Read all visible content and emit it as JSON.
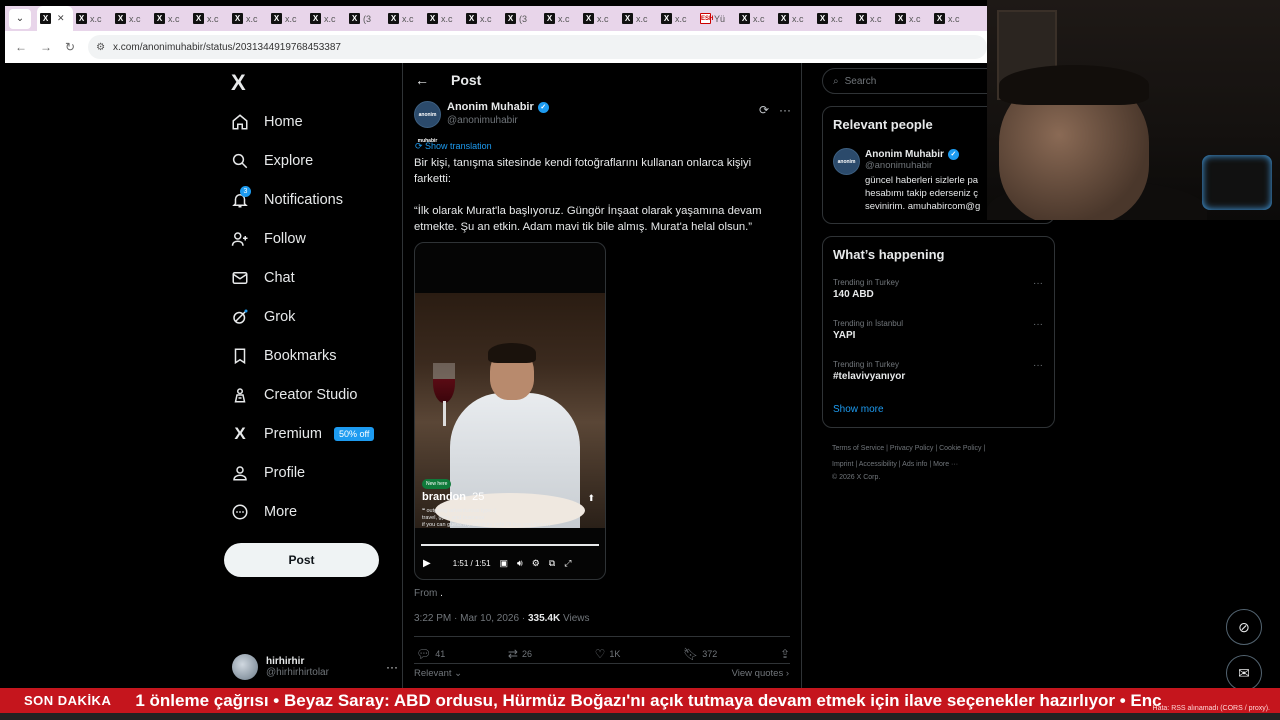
{
  "browser": {
    "tabs": [
      {
        "label": "",
        "icon": "x-icon",
        "active": true
      },
      {
        "label": "x.c",
        "icon": "x-icon"
      },
      {
        "label": "x.c",
        "icon": "x-icon"
      },
      {
        "label": "x.c",
        "icon": "x-icon"
      },
      {
        "label": "x.c",
        "icon": "x-icon"
      },
      {
        "label": "x.c",
        "icon": "x-icon"
      },
      {
        "label": "x.c",
        "icon": "x-icon"
      },
      {
        "label": "x.c",
        "icon": "x-icon"
      },
      {
        "label": "(3",
        "icon": "x-icon"
      },
      {
        "label": "x.c",
        "icon": "x-icon"
      },
      {
        "label": "x.c",
        "icon": "x-icon"
      },
      {
        "label": "x.c",
        "icon": "x-icon"
      },
      {
        "label": "(3",
        "icon": "x-icon"
      },
      {
        "label": "x.c",
        "icon": "x-icon"
      },
      {
        "label": "x.c",
        "icon": "x-icon"
      },
      {
        "label": "x.c",
        "icon": "x-icon"
      },
      {
        "label": "x.c",
        "icon": "x-icon"
      },
      {
        "label": "Yü",
        "icon": "news-icon"
      },
      {
        "label": "x.c",
        "icon": "x-icon"
      },
      {
        "label": "x.c",
        "icon": "x-icon"
      },
      {
        "label": "x.c",
        "icon": "x-icon"
      },
      {
        "label": "x.c",
        "icon": "x-icon"
      },
      {
        "label": "x.c",
        "icon": "x-icon"
      },
      {
        "label": "x.c",
        "icon": "x-icon"
      }
    ],
    "url": "x.com/anonimuhabir/status/2031344919768453387"
  },
  "nav": {
    "logo": "X",
    "items": [
      {
        "label": "Home",
        "icon": "home-icon"
      },
      {
        "label": "Explore",
        "icon": "search-icon"
      },
      {
        "label": "Notifications",
        "icon": "bell-icon",
        "badge": "3"
      },
      {
        "label": "Follow",
        "icon": "follow-icon"
      },
      {
        "label": "Chat",
        "icon": "mail-icon"
      },
      {
        "label": "Grok",
        "icon": "grok-icon"
      },
      {
        "label": "Bookmarks",
        "icon": "bookmark-icon"
      },
      {
        "label": "Creator Studio",
        "icon": "creator-icon"
      },
      {
        "label": "Premium",
        "icon": "x-premium-icon",
        "badge": "50% off"
      },
      {
        "label": "Profile",
        "icon": "person-icon"
      },
      {
        "label": "More",
        "icon": "more-circle-icon"
      }
    ],
    "post_button": "Post",
    "account": {
      "name": "hirhirhir",
      "handle": "@hirhirhirtolar"
    }
  },
  "post": {
    "header_title": "Post",
    "author_name": "Anonim Muhabir",
    "author_handle": "@anonimuhabir",
    "avatar_text": "anonim muhabir",
    "show_translation": "Show translation",
    "text_p1": "Bir kişi, tanışma sitesinde kendi fotoğraflarını kullanan onlarca kişiyi farketti:",
    "text_p2": "“İlk olarak Murat'la başlıyoruz. Güngör İnşaat olarak yaşamına devam etmekte. Şu an etkin. Adam mavi tik bile almış. Murat'a helal olsun.”",
    "video": {
      "new_badge": "New here",
      "profile_name": "brandon",
      "profile_age": "25",
      "bio_line1": "❝ outgoing adventurous type :)",
      "bio_line2": "travel, gym, and business",
      "bio_line3": "if you can guess my ethnicity right I'll buy you dinner!",
      "time": "1:51 / 1:51",
      "progress": 1.0
    },
    "from_label": "From",
    "timestamp": "3:22 PM · Mar 10, 2026 · ",
    "views_count": "335.4K",
    "views_label": " Views",
    "replies": "41",
    "reposts": "26",
    "likes": "1K",
    "bookmarks": "372",
    "relevant": "Relevant ⌄",
    "view_quotes": "View quotes ›"
  },
  "sidebar": {
    "search_placeholder": "Search",
    "relevant_title": "Relevant people",
    "rp_name": "Anonim Muhabir",
    "rp_handle": "@anonimuhabir",
    "rp_bio1": "güncel haberleri sizlerle pa",
    "rp_bio2": "hesabımı takip ederseniz ç",
    "rp_bio3": "sevinirim. amuhabircom@g",
    "happening_title": "What’s happening",
    "trends": [
      {
        "category": "Trending in Turkey",
        "name": "140 ABD"
      },
      {
        "category": "Trending in İstanbul",
        "name": "YAPI"
      },
      {
        "category": "Trending in Turkey",
        "name": "#telavivyanıyor"
      }
    ],
    "show_more": "Show more",
    "footer_line1": "Terms of Service  |  Privacy Policy  |  Cookie Policy  |",
    "footer_line2": "Imprint  |  Accessibility  |  Ads info  |  More ···",
    "footer_line3": "© 2026 X Corp."
  },
  "ticker": {
    "label": "SON DAKİKA",
    "text": "1 önleme çağrısı   •   Beyaz Saray: ABD ordusu, Hürmüz Boğazı'nı açık tutmaya devam etmek için ilave seçenekler hazırlıyor   •   Enc",
    "error": "Hata: RSS alınamadı (CORS / proxy)."
  }
}
